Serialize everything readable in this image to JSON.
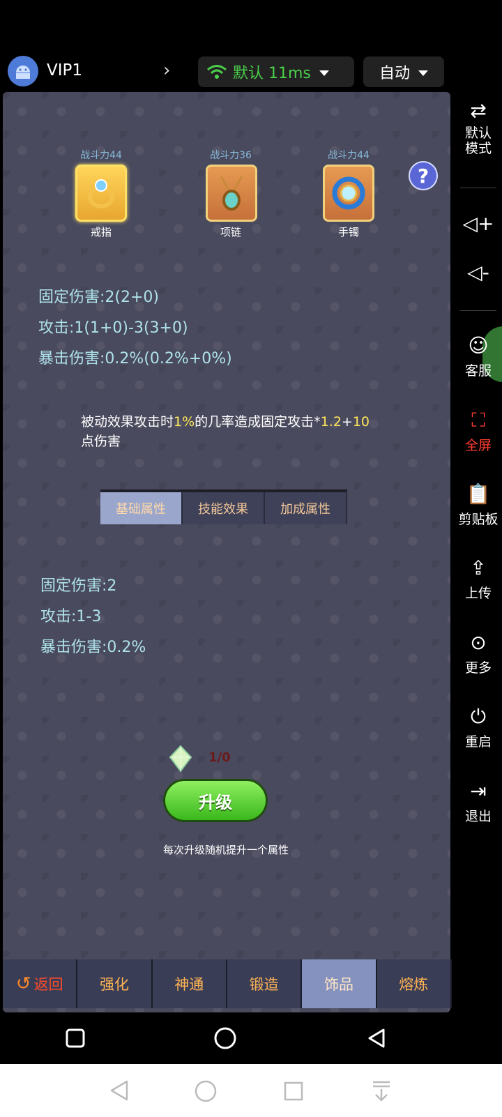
{
  "topbar": {
    "vip": "VIP1",
    "network": "默认 11ms",
    "mode": "自动"
  },
  "equipment": [
    {
      "power": "战斗力44",
      "name": "戒指",
      "selected": true
    },
    {
      "power": "战斗力36",
      "name": "项链",
      "selected": false
    },
    {
      "power": "战斗力44",
      "name": "手镯",
      "selected": false
    }
  ],
  "stats_top": [
    "固定伤害:2(2+0)",
    "攻击:1(1+0)-3(3+0)",
    "暴击伤害:0.2%(0.2%+0%)"
  ],
  "passive": {
    "p1": "被动效果攻击时",
    "p2": "1%",
    "p3": "的几率造成固定攻击*",
    "p4": "1.2",
    "p5": "+",
    "p6": "10",
    "p7": "点伤害"
  },
  "tabs": [
    "基础属性",
    "技能效果",
    "加成属性"
  ],
  "stats_bottom": [
    "固定伤害:2",
    "攻击:1-3",
    "暴击伤害:0.2%"
  ],
  "upgrade": {
    "count": "1/0",
    "button": "升级",
    "hint": "每次升级随机提升一个属性"
  },
  "bottom_tabs": {
    "back": "返回",
    "t1": "强化",
    "t2": "神通",
    "t3": "锻造",
    "t4": "饰品",
    "t5": "熔炼"
  },
  "side": {
    "mode": "默认\n模式",
    "service": "客服",
    "fullscreen": "全屏",
    "clipboard": "剪贴板",
    "upload": "上传",
    "more": "更多",
    "restart": "重启",
    "exit": "退出"
  },
  "colors": {
    "accent_green": "#4ad04a",
    "fullscreen_red": "#ff3b2f",
    "highlight": "#ffe65a"
  }
}
